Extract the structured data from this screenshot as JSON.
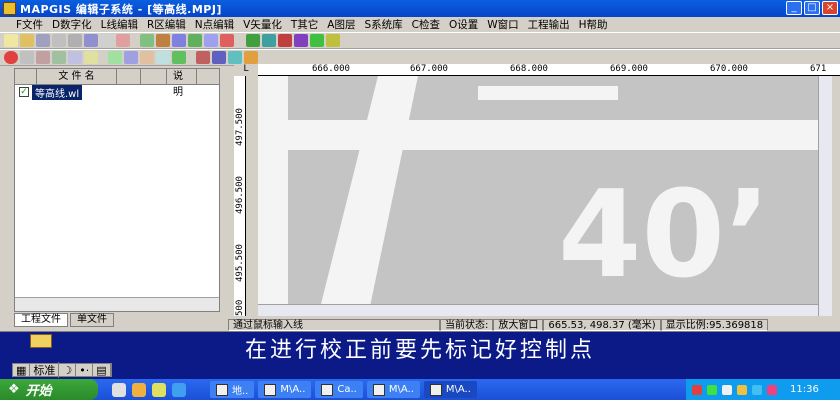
{
  "window": {
    "title": "MAPGIS 编辑子系统 - [等高线.MPJ]"
  },
  "menu": [
    "F文件",
    "D数字化",
    "L线编辑",
    "R区编辑",
    "N点编辑",
    "V矢量化",
    "T其它",
    "A图层",
    "S系统库",
    "C检查",
    "O设置",
    "W窗口",
    "工程输出",
    "H帮助"
  ],
  "panel": {
    "headers": [
      "文 件 名",
      "",
      "说明"
    ],
    "file": "等高线.wl",
    "tabs": [
      "工程文件",
      "单文件"
    ]
  },
  "rulers": {
    "x_ticks": [
      "666.000",
      "667.000",
      "668.000",
      "669.000",
      "670.000",
      "671"
    ],
    "y_ticks": [
      "497.500",
      "496.500",
      "495.500",
      "500"
    ],
    "corner": "L"
  },
  "canvas": {
    "text": "40’"
  },
  "status": {
    "hint": "通过鼠标输入线",
    "state_label": "当前状态:",
    "state_value": "放大窗口",
    "coords": "665.53, 498.37 (毫米)",
    "scale": "显示比例:95.369818"
  },
  "subtitle": "在进行校正前要先标记好控制点",
  "langbar": {
    "label": "标准"
  },
  "taskbar": {
    "start": "开始",
    "tasks": [
      "地..",
      "M\\A..",
      "Ca..",
      "M\\A..",
      "M\\A.."
    ],
    "clock": "11:36"
  },
  "colors": {
    "titlebar": "#0843c8",
    "selection": "#0a246a",
    "map_fill": "#c8c8c8"
  }
}
